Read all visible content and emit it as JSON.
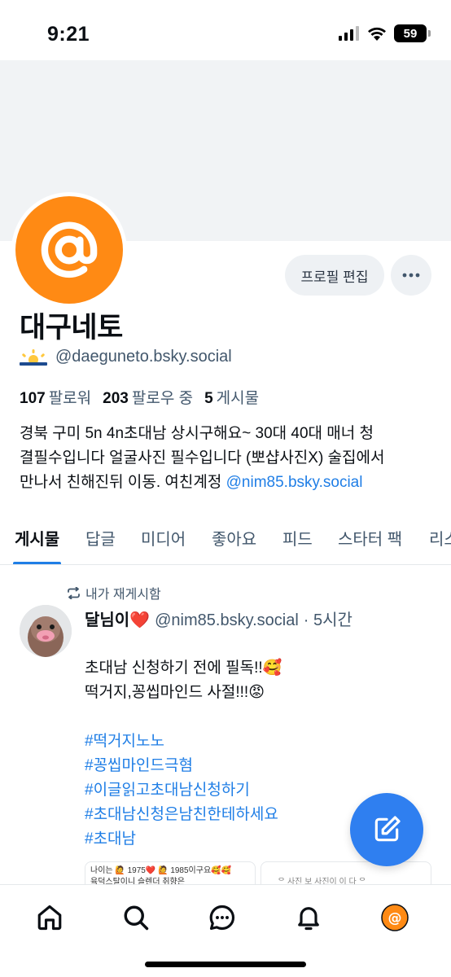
{
  "status_bar": {
    "time": "9:21",
    "battery": "59"
  },
  "profile": {
    "display_name": "대구네토",
    "handle": "@daeguneto.bsky.social",
    "edit_button": "프로필 편집",
    "stats": {
      "followers_count": "107",
      "followers_label": "팔로워",
      "following_count": "203",
      "following_label": "팔로우 중",
      "posts_count": "5",
      "posts_label": "게시물"
    },
    "bio_line1": "경북 구미 5n 4n초대남 상시구해요~ 30대 40대 매너 청",
    "bio_line2": "결필수입니다 얼굴사진 필수입니다 (뽀샵사진X) 술집에서",
    "bio_line3": "만나서 친해진뒤 이동. 여친계정 ",
    "bio_link": "@nim85.bsky.social"
  },
  "tabs": [
    "게시물",
    "답글",
    "미디어",
    "좋아요",
    "피드",
    "스타터 팩",
    "리스"
  ],
  "post": {
    "repost_label": "내가 재게시함",
    "author": "달님이❤️",
    "handle": "@nim85.bsky.social",
    "time": "· 5시간",
    "body_line1": "초대남 신청하기 전에 필독!!🥰",
    "body_line2": "떡거지,꽁씹마인드 사절!!!😡",
    "hashtags": [
      "#떡거지노노",
      "#꽁씹마인드극혐",
      "#이글읽고초대남신청하기",
      "#초대남신청은남친한테하세요",
      "#초대남"
    ],
    "embed_left_line1": "나이는 🙋 1975❤️ 🙋 1985이구요🥰🥰",
    "embed_left_line2": "육덕스탈이니 슬렌더 취향은",
    "embed_right_line1": "ᄋ 사진 보 사진이 이 다 ᄋ"
  },
  "colors": {
    "accent": "#1f7ee6",
    "avatar": "#ff8a14",
    "fab": "#2f7ff0"
  },
  "nav_icons": [
    "home-icon",
    "search-icon",
    "chat-icon",
    "bell-icon",
    "profile-avatar-icon"
  ]
}
